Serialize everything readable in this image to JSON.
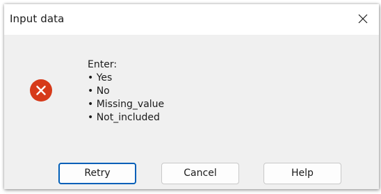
{
  "window": {
    "title": "Input data"
  },
  "icons": {
    "close": "close-icon",
    "status": "error-icon",
    "status_color": "#d63a1a"
  },
  "message": {
    "lines": [
      "Enter:",
      "• Yes",
      "• No",
      "• Missing_value",
      "• Not_included"
    ]
  },
  "buttons": {
    "retry": "Retry",
    "cancel": "Cancel",
    "help": "Help",
    "default": "Retry",
    "accent_color": "#005fb8"
  }
}
